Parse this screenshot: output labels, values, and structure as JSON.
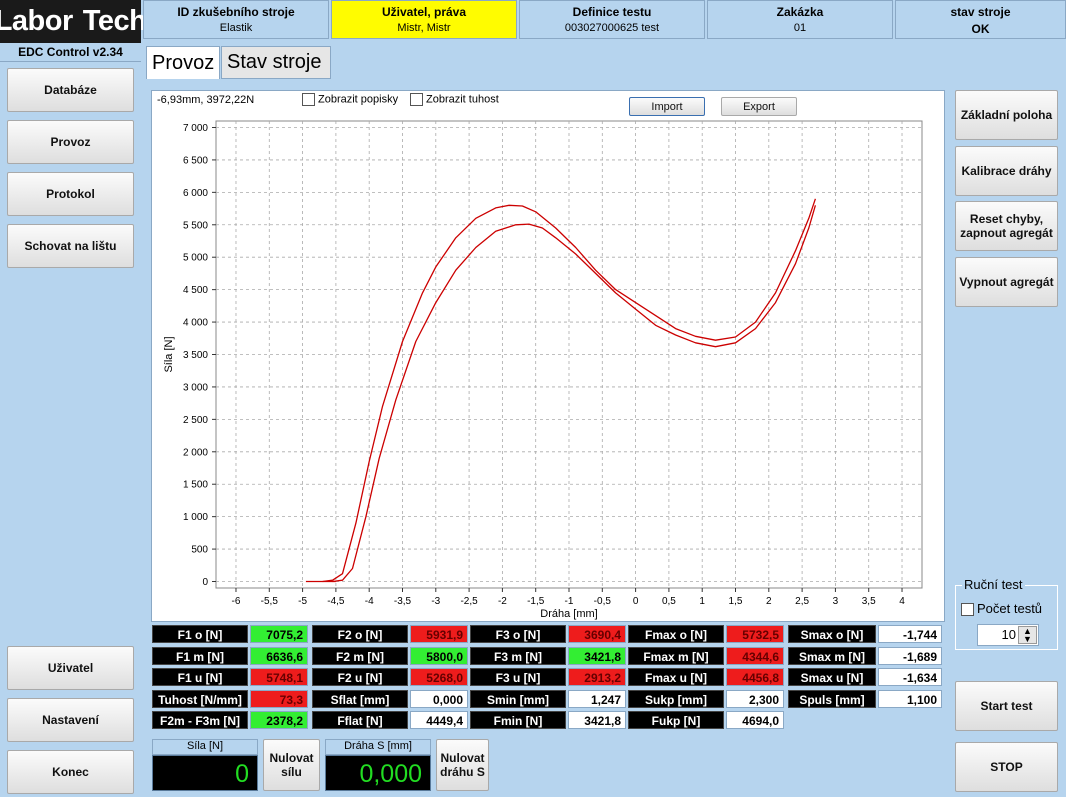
{
  "logo": {
    "left": "Labor",
    "right": "Tech"
  },
  "version": "EDC Control v2.34",
  "header": [
    {
      "title": "ID zkušebního stroje",
      "value": "Elastik",
      "yellow": false
    },
    {
      "title": "Uživatel, práva",
      "value": "Mistr, Mistr",
      "yellow": true
    },
    {
      "title": "Definice testu",
      "value": "003027000625 test",
      "yellow": false
    },
    {
      "title": "Zakázka",
      "value": "01",
      "yellow": false
    },
    {
      "title": "stav stroje",
      "value": "OK",
      "yellow": false
    }
  ],
  "left_nav": {
    "databaze": "Databáze",
    "provoz": "Provoz",
    "protokol": "Protokol",
    "schovat": "Schovat na lištu",
    "uzivatel": "Uživatel",
    "nastaveni": "Nastavení",
    "konec": "Konec"
  },
  "tabs": {
    "provoz": "Provoz",
    "stav": "Stav stroje"
  },
  "chart_top": {
    "coords": "-6,93mm, 3972,22N",
    "popisky": "Zobrazit popisky",
    "tuhost": "Zobrazit tuhost",
    "import": "Import",
    "export": "Export"
  },
  "chart_data": {
    "type": "line",
    "xlabel": "Dráha [mm]",
    "ylabel": "Síla [N]",
    "xlim": [
      -6.3,
      4.3
    ],
    "ylim": [
      -100,
      7100
    ],
    "xticks": [
      "-6",
      "-5,5",
      "-5",
      "-4,5",
      "-4",
      "-3,5",
      "-3",
      "-2,5",
      "-2",
      "-1,5",
      "-1",
      "-0,5",
      "0",
      "0,5",
      "1",
      "1,5",
      "2",
      "2,5",
      "3",
      "3,5",
      "4"
    ],
    "yticks": [
      "0",
      "500",
      "1 000",
      "1 500",
      "2 000",
      "2 500",
      "3 000",
      "3 500",
      "4 000",
      "4 500",
      "5 000",
      "5 500",
      "6 000",
      "6 500",
      "7 000"
    ],
    "grid": true,
    "series": [
      {
        "color": "#cc0000",
        "x": [
          -4.7,
          -4.55,
          -4.4,
          -4.2,
          -4.0,
          -3.8,
          -3.5,
          -3.2,
          -3.0,
          -2.7,
          -2.4,
          -2.1,
          -1.9,
          -1.7,
          -1.5,
          -1.2,
          -0.9,
          -0.6,
          -0.3,
          0.0,
          0.3,
          0.6,
          0.9,
          1.2,
          1.5,
          1.8,
          2.1,
          2.4,
          2.6,
          2.7
        ],
        "y": [
          0,
          20,
          120,
          900,
          1850,
          2700,
          3700,
          4450,
          4850,
          5300,
          5600,
          5760,
          5800,
          5790,
          5700,
          5450,
          5150,
          4800,
          4500,
          4300,
          4100,
          3900,
          3780,
          3720,
          3770,
          4000,
          4450,
          5100,
          5600,
          5900
        ]
      },
      {
        "color": "#cc0000",
        "x": [
          -4.55,
          -4.4,
          -4.25,
          -4.05,
          -3.85,
          -3.6,
          -3.3,
          -3.0,
          -2.7,
          -2.4,
          -2.1,
          -1.8,
          -1.6,
          -1.4,
          -1.2,
          -0.9,
          -0.6,
          -0.3,
          0.0,
          0.3,
          0.6,
          0.9,
          1.2,
          1.5,
          1.8,
          2.1,
          2.4,
          2.6,
          2.7
        ],
        "y": [
          0,
          20,
          200,
          1000,
          1900,
          2800,
          3700,
          4300,
          4800,
          5150,
          5400,
          5500,
          5510,
          5450,
          5300,
          5050,
          4750,
          4450,
          4200,
          3950,
          3800,
          3680,
          3620,
          3680,
          3900,
          4300,
          4900,
          5450,
          5800
        ]
      }
    ]
  },
  "table": {
    "rows": [
      [
        {
          "l": "F1 o [N]",
          "v": "7075,2",
          "c": "g"
        },
        {
          "l": "F2 o [N]",
          "v": "5931,9",
          "c": "r"
        },
        {
          "l": "F3 o [N]",
          "v": "3690,4",
          "c": "r"
        },
        {
          "l": "Fmax o [N]",
          "v": "5732,5",
          "c": "r"
        },
        {
          "l": "Smax o [N]",
          "v": "-1,744",
          "c": "w"
        }
      ],
      [
        {
          "l": "F1 m [N]",
          "v": "6636,6",
          "c": "g"
        },
        {
          "l": "F2 m [N]",
          "v": "5800,0",
          "c": "g"
        },
        {
          "l": "F3 m [N]",
          "v": "3421,8",
          "c": "g"
        },
        {
          "l": "Fmax m [N]",
          "v": "4344,6",
          "c": "r"
        },
        {
          "l": "Smax m [N]",
          "v": "-1,689",
          "c": "w"
        }
      ],
      [
        {
          "l": "F1 u [N]",
          "v": "5748,1",
          "c": "r"
        },
        {
          "l": "F2 u [N]",
          "v": "5268,0",
          "c": "r"
        },
        {
          "l": "F3 u [N]",
          "v": "2913,2",
          "c": "r"
        },
        {
          "l": "Fmax u [N]",
          "v": "4456,8",
          "c": "r"
        },
        {
          "l": "Smax u [N]",
          "v": "-1,634",
          "c": "w"
        }
      ],
      [
        {
          "l": "Tuhost [N/mm]",
          "v": "73,3",
          "c": "r"
        },
        {
          "l": "Sflat [mm]",
          "v": "0,000",
          "c": "w"
        },
        {
          "l": "Smin [mm]",
          "v": "1,247",
          "c": "w"
        },
        {
          "l": "Sukp [mm]",
          "v": "2,300",
          "c": "w"
        },
        {
          "l": "Spuls [mm]",
          "v": "1,100",
          "c": "w"
        }
      ],
      [
        {
          "l": "F2m - F3m [N]",
          "v": "2378,2",
          "c": "g"
        },
        {
          "l": "Fflat [N]",
          "v": "4449,4",
          "c": "w"
        },
        {
          "l": "Fmin [N]",
          "v": "3421,8",
          "c": "w"
        },
        {
          "l": "Fukp [N]",
          "v": "4694,0",
          "c": "w"
        }
      ]
    ]
  },
  "bottom": {
    "sila_label": "Síla [N]",
    "sila_value": "0",
    "nulovat_silu": "Nulovat sílu",
    "draha_label": "Dráha S [mm]",
    "draha_value": "0,000",
    "nulovat_drahu": "Nulovat dráhu S"
  },
  "right": {
    "zakladni": "Základní poloha",
    "kalibrace": "Kalibrace dráhy",
    "reset": "Reset chyby, zapnout agregát",
    "vypnout": "Vypnout agregát",
    "rucni_test": "Ruční test",
    "pocet_testu": "Počet testů",
    "pocet_value": "10",
    "start": "Start test",
    "stop": "STOP"
  }
}
